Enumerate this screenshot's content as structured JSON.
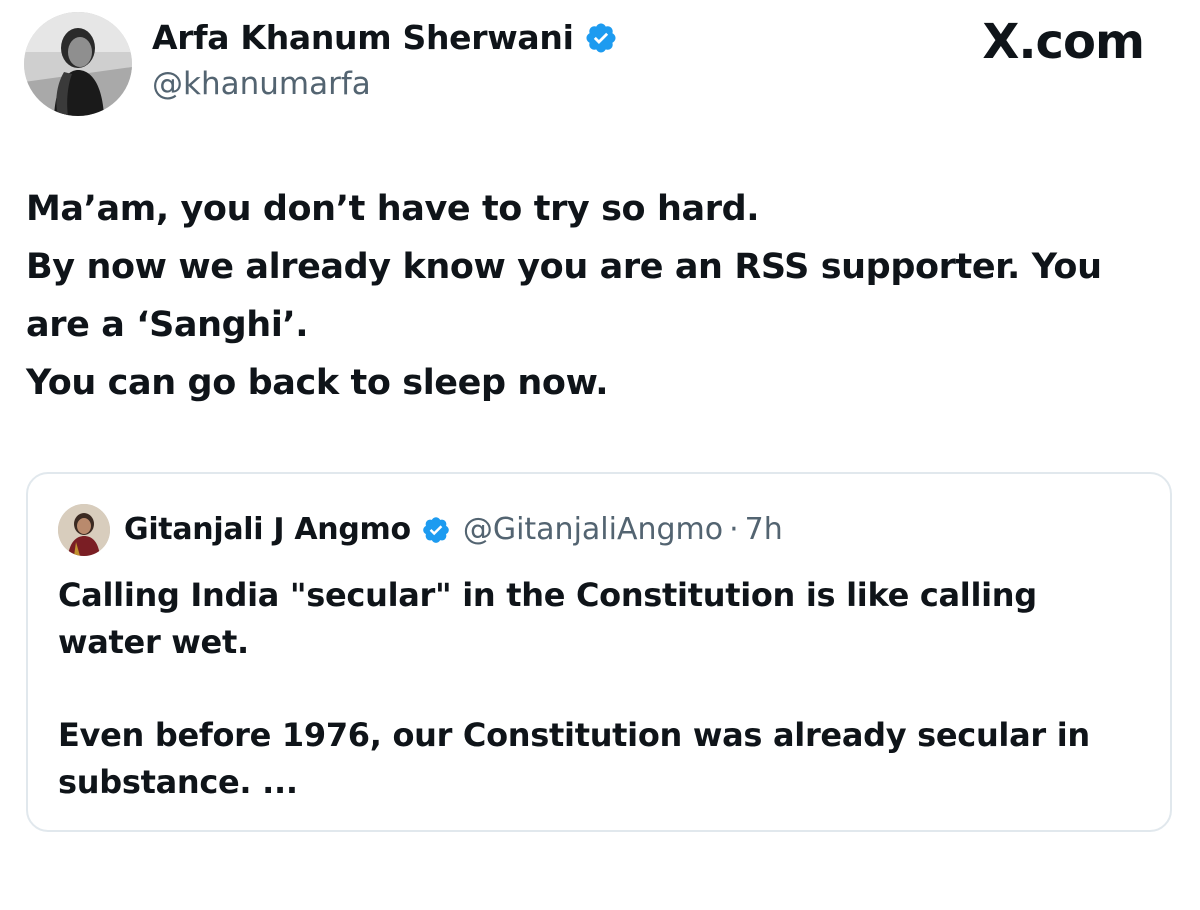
{
  "author": {
    "display_name": "Arfa Khanum Sherwani",
    "handle": "@khanumarfa",
    "avatar_icon": "profile-photo"
  },
  "brand": {
    "label": "X.com"
  },
  "tweet": {
    "lines": [
      "Ma’am, you don’t have to try so hard.",
      "By now we already know you are an RSS supporter. You",
      "are a ‘Sanghi’.",
      "You can go back to sleep now."
    ]
  },
  "quoted_tweet": {
    "display_name": "Gitanjali J Angmo",
    "handle": "@GitanjaliAngmo",
    "separator": "·",
    "time": "7h",
    "paragraph1": [
      "Calling India \"secular\" in the Constitution is like calling",
      "water wet."
    ],
    "paragraph2": [
      "Even before 1976, our Constitution was already secular in",
      "substance. ..."
    ]
  },
  "colors": {
    "verified": "#1d9bf0",
    "secondary_text": "#536471",
    "card_border": "#e1e8ed"
  }
}
